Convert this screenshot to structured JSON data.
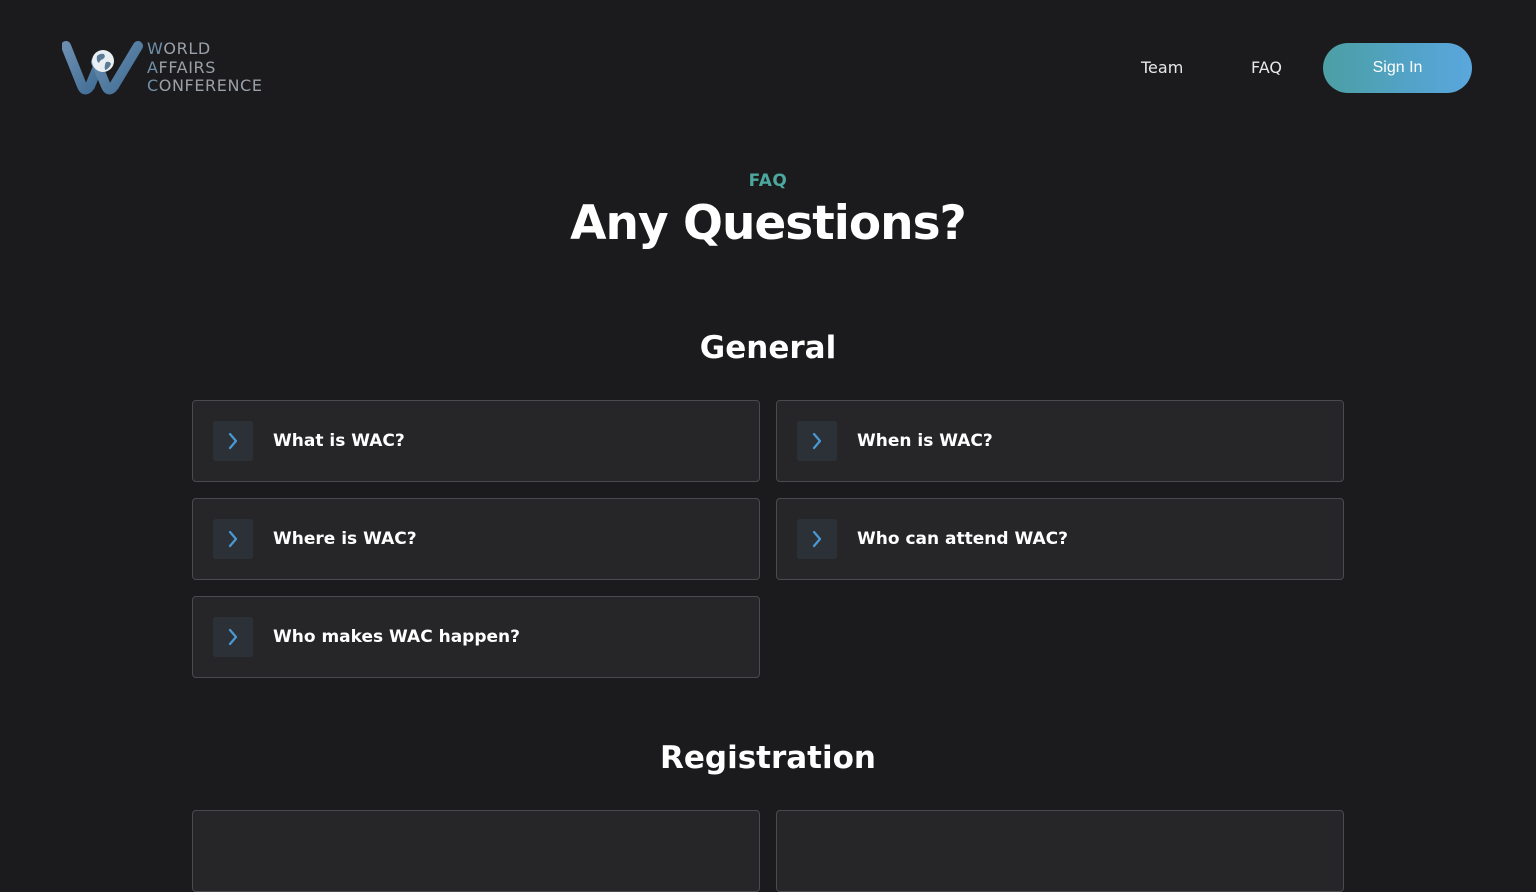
{
  "header": {
    "logo": {
      "lines": [
        {
          "initial": "W",
          "rest": "ORLD"
        },
        {
          "initial": "A",
          "rest": "FFAIRS"
        },
        {
          "initial": "C",
          "rest": "ONFERENCE"
        }
      ],
      "icon": "wac-globe-logo"
    },
    "nav": {
      "team_label": "Team",
      "faq_label": "FAQ"
    },
    "signin_label": "Sign In"
  },
  "hero": {
    "eyebrow": "FAQ",
    "title": "Any Questions?"
  },
  "sections": {
    "general": {
      "title": "General",
      "items": [
        {
          "question": "What is WAC?"
        },
        {
          "question": "When is WAC?"
        },
        {
          "question": "Where is WAC?"
        },
        {
          "question": "Who can attend WAC?"
        },
        {
          "question": "Who makes WAC happen?"
        }
      ]
    },
    "registration": {
      "title": "Registration"
    }
  },
  "colors": {
    "background": "#1b1b1d",
    "accent": "#4ca89e",
    "button_gradient_start": "#4c9fa3",
    "button_gradient_end": "#5aa7dd",
    "chevron": "#4a9ad4"
  },
  "icons": {
    "faq_item": "chevron-right-icon"
  }
}
